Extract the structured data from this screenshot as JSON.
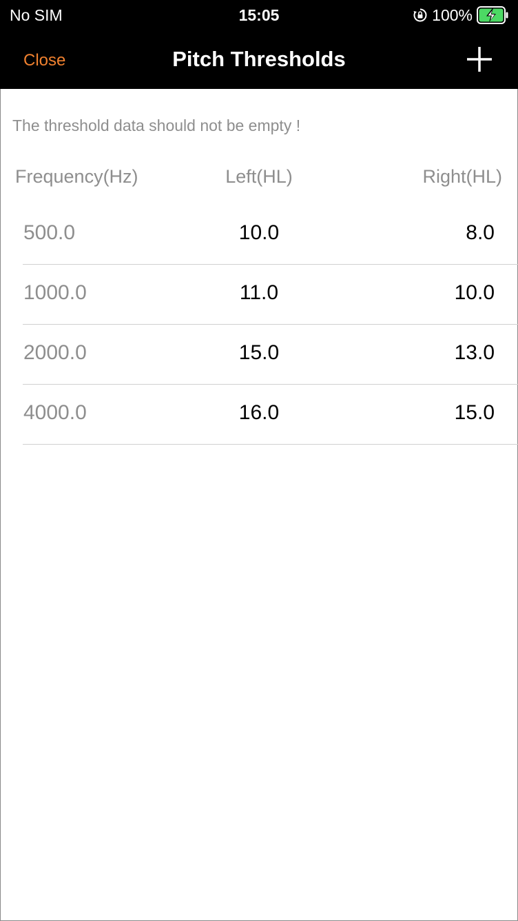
{
  "status_bar": {
    "carrier": "No SIM",
    "time": "15:05",
    "battery_percent": "100%",
    "battery_level": 1.0,
    "charging": true,
    "battery_color": "#4cd964"
  },
  "nav": {
    "close_label": "Close",
    "title": "Pitch Thresholds",
    "add_icon": "plus-icon",
    "accent_color": "#f0812f"
  },
  "warning_text": "The threshold data should not be empty !",
  "table": {
    "headers": {
      "frequency": "Frequency(Hz)",
      "left": "Left(HL)",
      "right": "Right(HL)"
    },
    "rows": [
      {
        "frequency": "500.0",
        "left": "10.0",
        "right": "8.0"
      },
      {
        "frequency": "1000.0",
        "left": "11.0",
        "right": "10.0"
      },
      {
        "frequency": "2000.0",
        "left": "15.0",
        "right": "13.0"
      },
      {
        "frequency": "4000.0",
        "left": "16.0",
        "right": "15.0"
      }
    ]
  }
}
